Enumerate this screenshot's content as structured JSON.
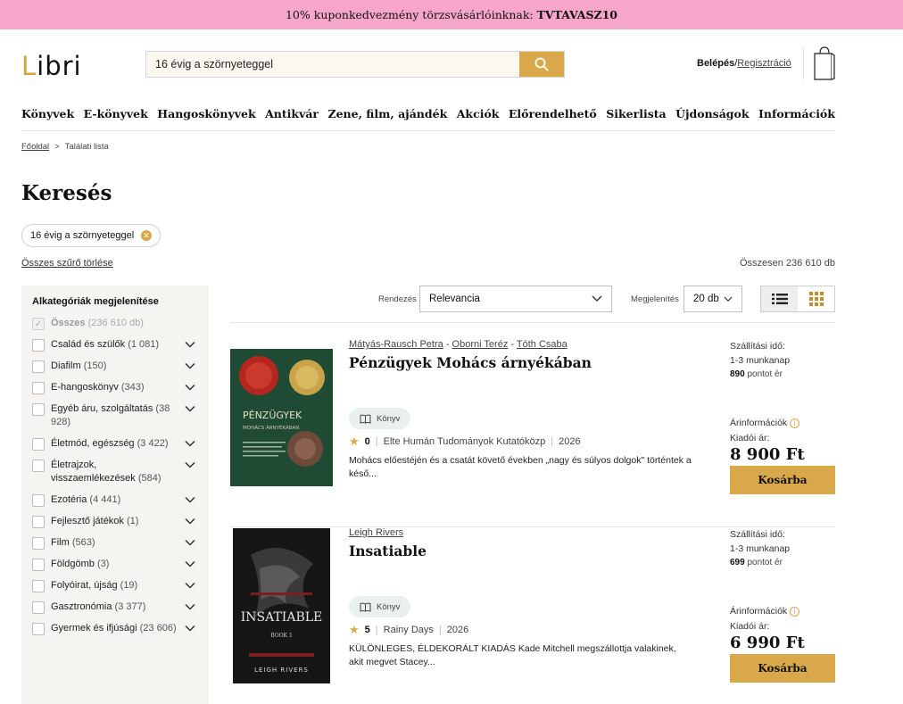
{
  "promo": {
    "text": "10% kuponkedvezmény törzsvásárlóinknak:",
    "code": "TVTAVASZ10"
  },
  "header": {
    "logo": {
      "first": "L",
      "rest": "ibri"
    },
    "search_value": "16 évig a szörnyeteggel",
    "login": "Belépés",
    "slash": "/",
    "register": "Regisztráció"
  },
  "nav": [
    "Könyvek",
    "E-könyvek",
    "Hangoskönyvek",
    "Antikvár",
    "Zene, film, ajándék",
    "Akciók",
    "Előrendelhető",
    "Sikerlista",
    "Újdonságok",
    "Információk"
  ],
  "breadcrumb": {
    "home": "Főoldal",
    "sep": ">",
    "current": "Találati lista"
  },
  "page_title": "Keresés",
  "filter_chip": "16 évig a szörnyeteggel",
  "clear_all": "Összes szűrő törlése",
  "total": "Összesen 236 610 db",
  "sidebar": {
    "heading": "Alkategóriák megjelenítése",
    "all": {
      "label": "Összes",
      "count": "(236 610 db)"
    },
    "items": [
      {
        "label": "Család és szülők",
        "count": "(1 081)"
      },
      {
        "label": "Diafilm",
        "count": "(150)"
      },
      {
        "label": "E-hangoskönyv",
        "count": "(343)"
      },
      {
        "label": "Egyéb áru, szolgáltatás",
        "count": "(38 928)"
      },
      {
        "label": "Életmód, egészség",
        "count": "(3 422)"
      },
      {
        "label": "Életrajzok, visszaemlékezések",
        "count": "(584)"
      },
      {
        "label": "Ezotéria",
        "count": "(4 441)"
      },
      {
        "label": "Fejlesztő játékok",
        "count": "(1)"
      },
      {
        "label": "Film",
        "count": "(563)"
      },
      {
        "label": "Földgömb",
        "count": "(3)"
      },
      {
        "label": "Folyóirat, újság",
        "count": "(19)"
      },
      {
        "label": "Gasztronómia",
        "count": "(3 377)"
      },
      {
        "label": "Gyermek és ifjúsági",
        "count": "(23 606)"
      }
    ]
  },
  "toolbar": {
    "sort_label": "Rendezés",
    "sort_value": "Relevancia",
    "display_label": "Megjelenítés",
    "display_value": "20 db"
  },
  "products": [
    {
      "authors": [
        "Mátyás-Rausch Petra",
        "Oborni Teréz",
        "Tóth Csaba"
      ],
      "title": "Pénzügyek Mohács árnyékában",
      "cover_title": "PÉNZÜGYEK",
      "cover_sub": "MOHÁCS ÁRNYÉKÁBAN",
      "format": "Könyv",
      "rating": "0",
      "publisher": "Elte Humán Tudományok Kutatóközp",
      "year": "2026",
      "description": "Mohács előestéjén és a csatát követő években „nagy és súlyos dolgok\" történtek a késő...",
      "ship_label": "Szállítási idő:",
      "ship_value": "1-3 munkanap",
      "points": "890",
      "points_suffix": "pontot ér",
      "price_info": "Árinformációk",
      "publisher_price_label": "Kiadói ár:",
      "price": "8 900 Ft",
      "cart": "Kosárba"
    },
    {
      "authors": [
        "Leigh Rivers"
      ],
      "title": "Insatiable",
      "cover_title": "INSATIABLE",
      "cover_sub": "BOOK 1",
      "cover_author": "LEIGH RIVERS",
      "format": "Könyv",
      "rating": "5",
      "publisher": "Rainy Days",
      "year": "2026",
      "description": "KÜLÖNLEGES, ÉLDEKORÁLT KIADÁS Kade Mitchell megszállottja valakinek, akit megvet Stacey...",
      "ship_label": "Szállítási idő:",
      "ship_value": "1-3 munkanap",
      "points": "699",
      "points_suffix": "pontot ér",
      "price_info": "Árinformációk",
      "publisher_price_label": "Kiadói ár:",
      "price": "6 990 Ft",
      "cart": "Kosárba"
    }
  ]
}
